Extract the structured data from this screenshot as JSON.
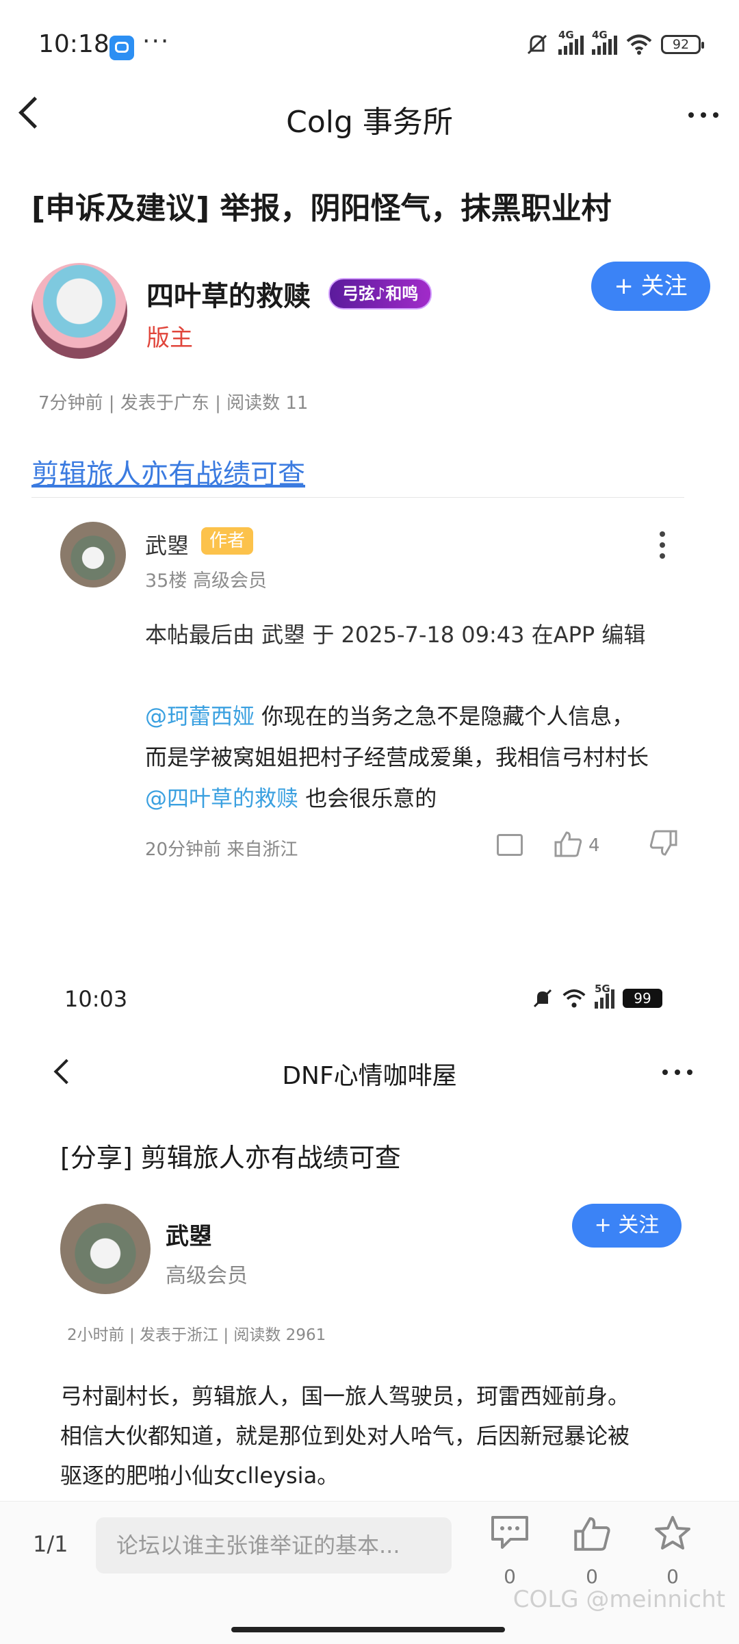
{
  "status_bar": {
    "time": "10:18",
    "dots": "···",
    "net1": "4G",
    "net2": "4G",
    "battery": "92"
  },
  "header": {
    "title": "Colg 事务所"
  },
  "post": {
    "title": "[申诉及建议] 举报，阴阳怪气，抹黑职业村",
    "author": "四叶草的救赎",
    "honor_badge": "弓弦♪和鸣",
    "role": "版主",
    "follow_label": "+ 关注",
    "meta": "7分钟前 | 发表于广东 | 阅读数 11",
    "link_title": "剪辑旅人亦有战绩可查"
  },
  "reply": {
    "name": "武曌",
    "tag": "作者",
    "meta": "35楼 高级会员",
    "edit_note": "本帖最后由 武曌 于 2025-7-18 09:43 在APP 编辑",
    "mention1": "@珂蕾西娅",
    "text1": " 你现在的当务之急不是隐藏个人信息，",
    "text2": "而是学被窝姐姐把村子经营成爱巢，我相信弓村村长",
    "mention2": "@四叶草的救赎",
    "text3": " 也会很乐意的",
    "time": "20分钟前 来自浙江",
    "like_count": "4"
  },
  "embedded": {
    "time": "10:03",
    "net": "5G",
    "battery": "99",
    "header_title": "DNF心情咖啡屋",
    "post_title": "[分享] 剪辑旅人亦有战绩可查",
    "author": "武曌",
    "member": "高级会员",
    "follow_label": "+ 关注",
    "meta": "2小时前 | 发表于浙江 | 阅读数 2961",
    "body_line1": "弓村副村长，剪辑旅人，国一旅人驾驶员，珂雷西娅前身。",
    "body_line2": "相信大伙都知道，就是那位到处对人哈气，后因新冠暴论被",
    "body_line3": "驱逐的肥啪小仙女clleysia。"
  },
  "bottom_bar": {
    "page": "1/1",
    "input_placeholder": "论坛以谁主张谁举证的基本...",
    "comment_count": "0",
    "like_count": "0",
    "fav_count": "0",
    "watermark": "COLG @meinnicht"
  }
}
